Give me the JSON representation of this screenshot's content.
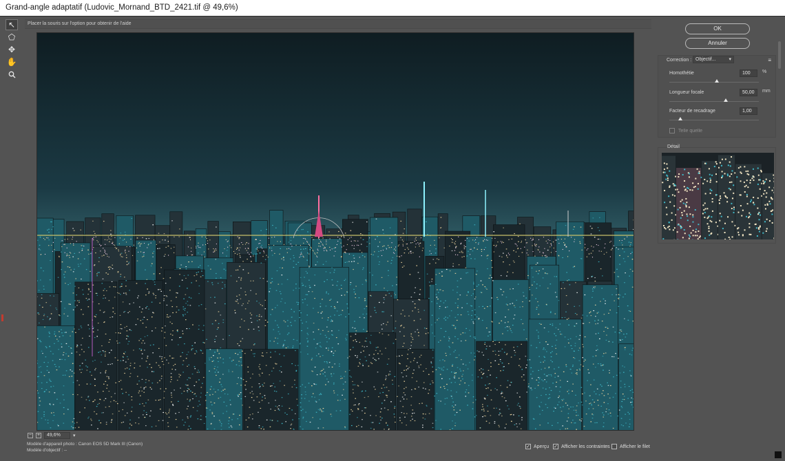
{
  "window": {
    "title": "Grand-angle adaptatif (Ludovic_Mornand_BTD_2421.tif @ 49,6%)"
  },
  "hint": {
    "text": "Placer la souris sur l'option pour obtenir de l'aide"
  },
  "tools": [
    {
      "name": "constraint-tool-icon",
      "glyph": "↖"
    },
    {
      "name": "polygon-constraint-tool-icon",
      "glyph": "⬠"
    },
    {
      "name": "move-tool-icon",
      "glyph": "✥"
    },
    {
      "name": "hand-tool-icon",
      "glyph": "✋"
    },
    {
      "name": "zoom-tool-icon",
      "glyph": "🔍"
    }
  ],
  "zoom": {
    "value": "49,6%"
  },
  "camera": {
    "model_line": "Modèle d'appareil photo : Canon EOS 5D Mark III (Canon)",
    "lens_line": "Modèle d'objectif : --"
  },
  "buttons": {
    "ok": "OK",
    "cancel": "Annuler"
  },
  "correction": {
    "label": "Correction :",
    "value": "Objectif...",
    "params": [
      {
        "label": "Homothétie",
        "value": "100",
        "unit": "%",
        "slider": 0.53
      },
      {
        "label": "Longueur focale",
        "value": "50,00",
        "unit": "mm",
        "slider": 0.63
      },
      {
        "label": "Facteur de recadrage",
        "value": "1,00",
        "unit": "",
        "slider": 0.12
      }
    ],
    "as_shot": "Telle quelle"
  },
  "detail": {
    "label": "Détail"
  },
  "checkboxes": {
    "preview": {
      "label": "Aperçu",
      "checked": true
    },
    "show_constraints": {
      "label": "Afficher les contraintes",
      "checked": true
    },
    "show_mesh": {
      "label": "Afficher le filet",
      "checked": false
    }
  },
  "colors": {
    "sky_top": "#0f1e24",
    "sky_bottom": "#1d3b45",
    "horizon": "#c8c06a",
    "city_teal": "#3fb8c8",
    "lights": "#f3d9a0"
  }
}
